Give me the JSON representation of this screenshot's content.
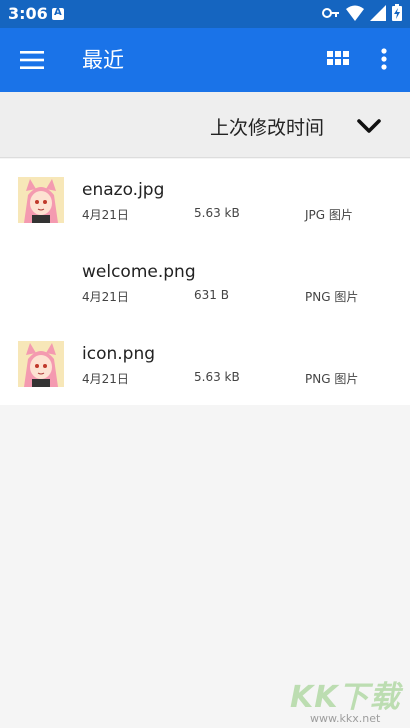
{
  "status_bar": {
    "time": "3:06",
    "icons": [
      "app-notification-icon",
      "vpn-key-icon",
      "wifi-icon",
      "signal-icon",
      "battery-icon"
    ]
  },
  "app_bar": {
    "title": "最近",
    "icons": [
      "menu-icon",
      "grid-view-icon",
      "more-vert-icon"
    ],
    "color": "#1a73e8"
  },
  "sort_bar": {
    "label": "上次修改时间",
    "icon": "chevron-down-icon"
  },
  "files": [
    {
      "name": "enazo.jpg",
      "date": "4月21日",
      "size": "5.63 kB",
      "type": "JPG 图片",
      "thumbnail": "anime-girl-thumbnail"
    },
    {
      "name": "welcome.png",
      "date": "4月21日",
      "size": "631 B",
      "type": "PNG 图片",
      "thumbnail": ""
    },
    {
      "name": "icon.png",
      "date": "4月21日",
      "size": "5.63 kB",
      "type": "PNG 图片",
      "thumbnail": "anime-girl-thumbnail"
    }
  ],
  "watermark": {
    "text": "KK下载",
    "url": "www.kkx.net"
  }
}
